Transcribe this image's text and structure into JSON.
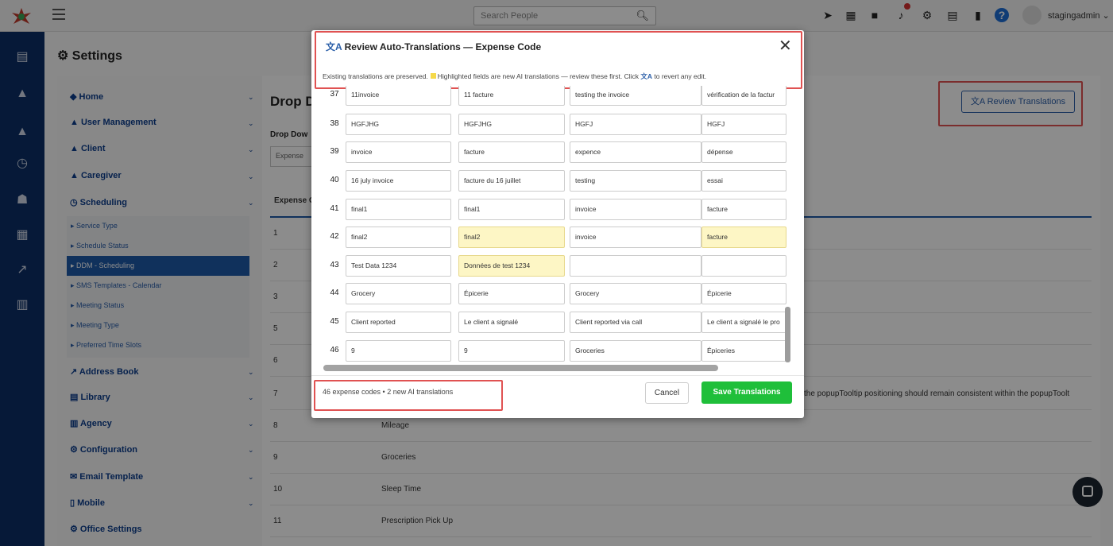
{
  "topbar": {
    "search_placeholder": "Search People",
    "username": "stagingadmin",
    "icons": [
      "rocket-icon",
      "calendar-icon",
      "book-icon",
      "bell-icon",
      "gear-icon",
      "chat-icon",
      "bookmark-icon",
      "help-icon"
    ]
  },
  "page": {
    "title": "Settings",
    "drop_title": "Drop D",
    "drop_sub": "Drop Dow",
    "drop_select": "Expense",
    "col_head": "Expense C",
    "overflow_text": "the popupTooltip positioning should remain consistent within the popupToolt",
    "review_button": "Review Translations"
  },
  "nav": {
    "items": [
      "Home",
      "User Management",
      "Client",
      "Caregiver",
      "Scheduling",
      "Address Book",
      "Library",
      "Agency",
      "Configuration",
      "Email Template",
      "Mobile",
      "Office Settings"
    ],
    "subitems": [
      "Service Type",
      "Schedule Status",
      "DDM - Scheduling",
      "SMS Templates - Calendar",
      "Meeting Status",
      "Meeting Type",
      "Preferred Time Slots"
    ]
  },
  "background_rows": [
    {
      "n": "1",
      "t": ""
    },
    {
      "n": "2",
      "t": ""
    },
    {
      "n": "3",
      "t": ""
    },
    {
      "n": "5",
      "t": ""
    },
    {
      "n": "6",
      "t": ""
    },
    {
      "n": "7",
      "t": ""
    },
    {
      "n": "8",
      "t": "Mileage"
    },
    {
      "n": "9",
      "t": "Groceries"
    },
    {
      "n": "10",
      "t": "Sleep Time"
    },
    {
      "n": "11",
      "t": "Prescription Pick Up"
    }
  ],
  "modal": {
    "title": "Review Auto-Translations — Expense Code",
    "info_before": "Existing translations are preserved.",
    "info_mid": "Highlighted fields are new AI translations — review these first. Click",
    "info_after": "to revert any edit.",
    "count_text": "46 expense codes • 2 new AI translations",
    "cancel": "Cancel",
    "save": "Save Translations",
    "rows": [
      {
        "num": "37",
        "en": "11invoice",
        "fr": "11 facture",
        "en2": "testing the invoice",
        "fr2": "vérification de la factur",
        "new": []
      },
      {
        "num": "38",
        "en": "HGFJHG",
        "fr": "HGFJHG",
        "en2": "HGFJ",
        "fr2": "HGFJ",
        "new": []
      },
      {
        "num": "39",
        "en": "invoice",
        "fr": "facture",
        "en2": "expence",
        "fr2": "dépense",
        "new": []
      },
      {
        "num": "40",
        "en": "16 july invoice",
        "fr": "facture du 16 juillet",
        "en2": "testing",
        "fr2": "essai",
        "new": []
      },
      {
        "num": "41",
        "en": "final1",
        "fr": "final1",
        "en2": "invoice",
        "fr2": "facture",
        "new": []
      },
      {
        "num": "42",
        "en": "final2",
        "fr": "final2",
        "en2": "invoice",
        "fr2": "facture",
        "new": [
          2,
          4
        ]
      },
      {
        "num": "43",
        "en": "Test Data 1234",
        "fr": "Données de test 1234",
        "en2": "",
        "fr2": "",
        "new": [
          2
        ]
      },
      {
        "num": "44",
        "en": "Grocery",
        "fr": "Épicerie",
        "en2": "Grocery",
        "fr2": "Épicerie",
        "new": []
      },
      {
        "num": "45",
        "en": "Client reported",
        "fr": "Le client a signalé",
        "en2": "Client reported via call",
        "fr2": "Le client a signalé le pro",
        "new": []
      },
      {
        "num": "46",
        "en": "9",
        "fr": "9",
        "en2": "Groceries",
        "fr2": "Épiceries",
        "new": []
      }
    ]
  }
}
